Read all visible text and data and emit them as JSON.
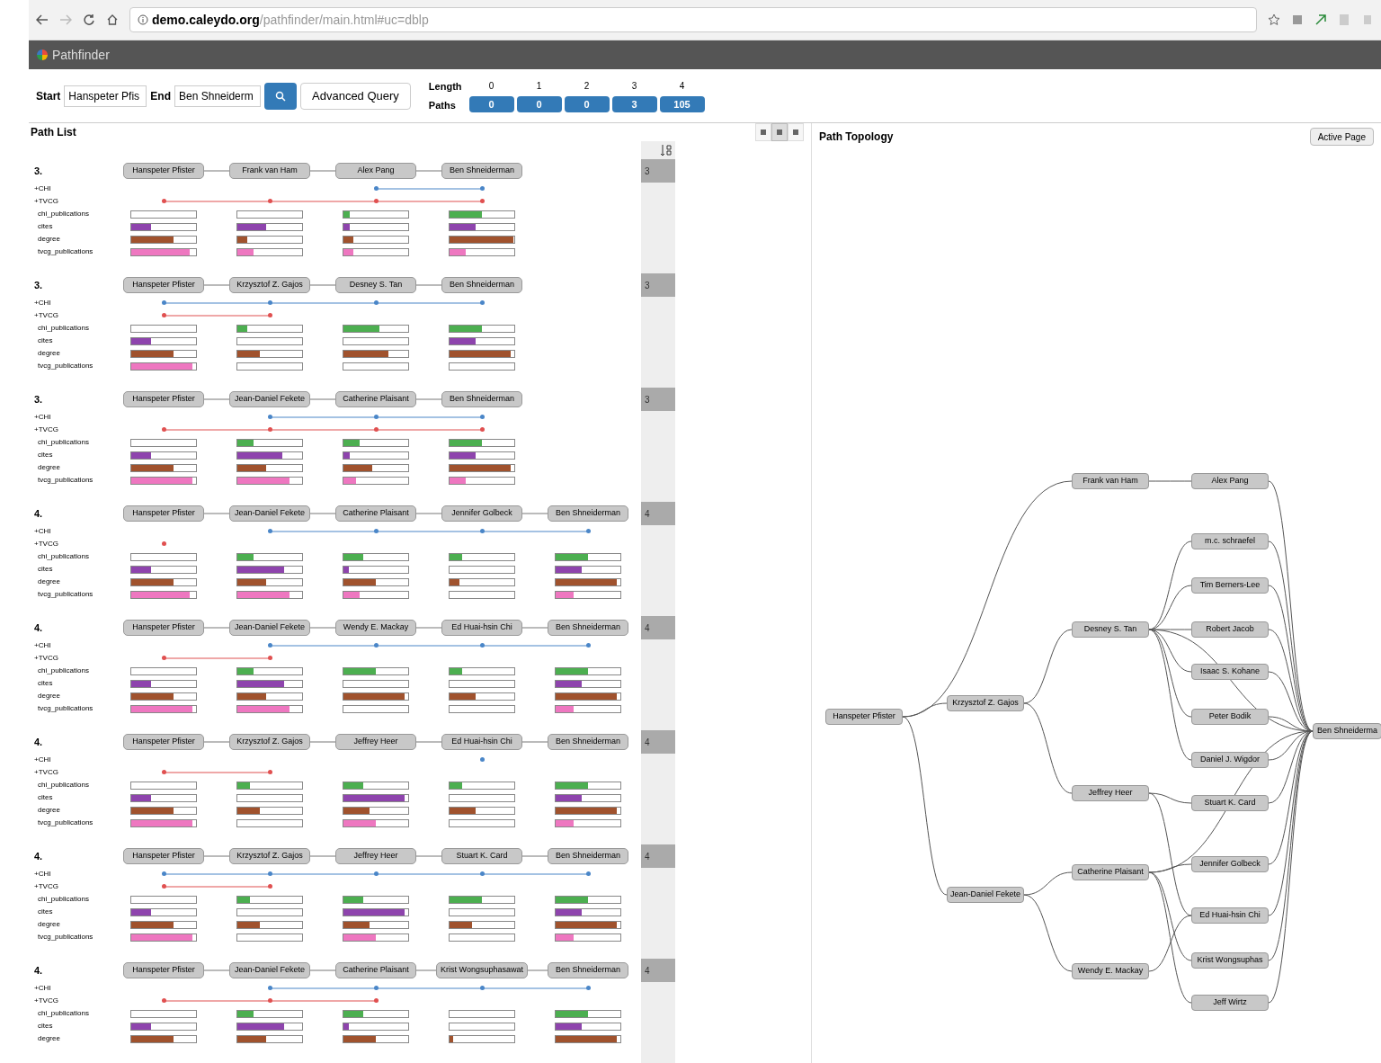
{
  "browser": {
    "url_host": "demo.caleydo.org",
    "url_path": "/pathfinder/main.html#uc=dblp"
  },
  "app": {
    "title": "Pathfinder"
  },
  "query": {
    "start_label": "Start",
    "start_value": "Hanspeter Pfis",
    "end_label": "End",
    "end_value": "Ben Shneiderm",
    "advanced_label": "Advanced Query",
    "length_label": "Length",
    "paths_label": "Paths",
    "length_columns": [
      {
        "length": "0",
        "paths": "0"
      },
      {
        "length": "1",
        "paths": "0"
      },
      {
        "length": "2",
        "paths": "0"
      },
      {
        "length": "3",
        "paths": "3"
      },
      {
        "length": "4",
        "paths": "105"
      }
    ]
  },
  "path_list": {
    "title": "Path List",
    "view_modes": [
      {
        "selected": false
      },
      {
        "selected": true
      },
      {
        "selected": false
      }
    ],
    "paths": [
      {
        "rank": "3.",
        "length": "3",
        "nodes": [
          "Hanspeter Pfister",
          "Frank van Ham",
          "Alex Pang",
          "Ben Shneiderman"
        ],
        "sets": [
          {
            "label": "+CHI",
            "color": "#4a86c8",
            "members": [
              false,
              false,
              true,
              true
            ]
          },
          {
            "label": "+TVCG",
            "color": "#e05050",
            "members": [
              true,
              true,
              true,
              true
            ]
          }
        ],
        "attributes": [
          {
            "label": "chi_publications",
            "color": "#4caf50",
            "values": [
              {
                "level": 0
              },
              {
                "level": 0
              },
              {
                "level": 0.1
              },
              {
                "level": 0.5
              }
            ]
          },
          {
            "label": "cites",
            "color": "#8e44ad",
            "values": [
              {
                "level": 0.3
              },
              {
                "level": 0.45
              },
              {
                "level": 0.1
              },
              {
                "level": 0.4
              }
            ]
          },
          {
            "label": "degree",
            "color": "#a0522d",
            "values": [
              {
                "level": 0.65
              },
              {
                "level": 0.15
              },
              {
                "level": 0.15
              },
              {
                "level": 0.98
              }
            ]
          },
          {
            "label": "tvcg_publications",
            "color": "#ee77c0",
            "values": [
              {
                "level": 0.9
              },
              {
                "level": 0.25
              },
              {
                "level": 0.15
              },
              {
                "level": 0.25
              }
            ]
          }
        ]
      },
      {
        "rank": "3.",
        "length": "3",
        "nodes": [
          "Hanspeter Pfister",
          "Krzysztof Z. Gajos",
          "Desney S. Tan",
          "Ben Shneiderman"
        ],
        "sets": [
          {
            "label": "+CHI",
            "color": "#4a86c8",
            "members": [
              true,
              true,
              true,
              true
            ]
          },
          {
            "label": "+TVCG",
            "color": "#e05050",
            "members": [
              true,
              true,
              false,
              false
            ]
          }
        ],
        "attributes": [
          {
            "label": "chi_publications",
            "color": "#4caf50",
            "values": [
              {
                "level": 0
              },
              {
                "level": 0.15
              },
              {
                "level": 0.55
              },
              {
                "level": 0.5
              }
            ]
          },
          {
            "label": "cites",
            "color": "#8e44ad",
            "values": [
              {
                "level": 0.3
              },
              {
                "level": 0
              },
              {
                "level": 0
              },
              {
                "level": 0.4
              }
            ]
          },
          {
            "label": "degree",
            "color": "#a0522d",
            "values": [
              {
                "level": 0.65
              },
              {
                "level": 0.35
              },
              {
                "level": 0.7
              },
              {
                "level": 0.95
              }
            ]
          },
          {
            "label": "tvcg_publications",
            "color": "#ee77c0",
            "values": [
              {
                "level": 0.95
              },
              {
                "level": 0
              },
              {
                "level": 0
              },
              {
                "level": 0
              }
            ]
          }
        ]
      },
      {
        "rank": "3.",
        "length": "3",
        "nodes": [
          "Hanspeter Pfister",
          "Jean-Daniel Fekete",
          "Catherine Plaisant",
          "Ben Shneiderman"
        ],
        "sets": [
          {
            "label": "+CHI",
            "color": "#4a86c8",
            "members": [
              false,
              true,
              true,
              true
            ]
          },
          {
            "label": "+TVCG",
            "color": "#e05050",
            "members": [
              true,
              true,
              true,
              true
            ]
          }
        ],
        "attributes": [
          {
            "label": "chi_publications",
            "color": "#4caf50",
            "values": [
              {
                "level": 0
              },
              {
                "level": 0.25
              },
              {
                "level": 0.25
              },
              {
                "level": 0.5
              }
            ]
          },
          {
            "label": "cites",
            "color": "#8e44ad",
            "values": [
              {
                "level": 0.3
              },
              {
                "level": 0.7
              },
              {
                "level": 0.1
              },
              {
                "level": 0.4
              }
            ]
          },
          {
            "label": "degree",
            "color": "#a0522d",
            "values": [
              {
                "level": 0.65
              },
              {
                "level": 0.45
              },
              {
                "level": 0.45
              },
              {
                "level": 0.95
              }
            ]
          },
          {
            "label": "tvcg_publications",
            "color": "#ee77c0",
            "values": [
              {
                "level": 0.95
              },
              {
                "level": 0.8
              },
              {
                "level": 0.2
              },
              {
                "level": 0.25
              }
            ]
          }
        ]
      },
      {
        "rank": "4.",
        "length": "4",
        "nodes": [
          "Hanspeter Pfister",
          "Jean-Daniel Fekete",
          "Catherine Plaisant",
          "Jennifer Golbeck",
          "Ben Shneiderman"
        ],
        "sets": [
          {
            "label": "+CHI",
            "color": "#4a86c8",
            "members": [
              false,
              true,
              true,
              true,
              true
            ]
          },
          {
            "label": "+TVCG",
            "color": "#e05050",
            "members": [
              true,
              false,
              false,
              false,
              false
            ]
          }
        ],
        "attributes": [
          {
            "label": "chi_publications",
            "color": "#4caf50",
            "values": [
              {
                "level": 0
              },
              {
                "level": 0.25
              },
              {
                "level": 0.3
              },
              {
                "level": 0.2
              },
              {
                "level": 0.5
              }
            ]
          },
          {
            "label": "cites",
            "color": "#8e44ad",
            "values": [
              {
                "level": 0.3
              },
              {
                "level": 0.72
              },
              {
                "level": 0.08
              },
              {
                "level": 0
              },
              {
                "level": 0.4
              }
            ]
          },
          {
            "label": "degree",
            "color": "#a0522d",
            "values": [
              {
                "level": 0.65
              },
              {
                "level": 0.45
              },
              {
                "level": 0.5
              },
              {
                "level": 0.15
              },
              {
                "level": 0.95
              }
            ]
          },
          {
            "label": "tvcg_publications",
            "color": "#ee77c0",
            "values": [
              {
                "level": 0.9
              },
              {
                "level": 0.8
              },
              {
                "level": 0.25
              },
              {
                "level": 0
              },
              {
                "level": 0.28
              }
            ]
          }
        ]
      },
      {
        "rank": "4.",
        "length": "4",
        "nodes": [
          "Hanspeter Pfister",
          "Jean-Daniel Fekete",
          "Wendy E. Mackay",
          "Ed Huai-hsin Chi",
          "Ben Shneiderman"
        ],
        "sets": [
          {
            "label": "+CHI",
            "color": "#4a86c8",
            "members": [
              false,
              true,
              true,
              true,
              true
            ]
          },
          {
            "label": "+TVCG",
            "color": "#e05050",
            "members": [
              true,
              true,
              false,
              false,
              false
            ]
          }
        ],
        "attributes": [
          {
            "label": "chi_publications",
            "color": "#4caf50",
            "values": [
              {
                "level": 0
              },
              {
                "level": 0.25
              },
              {
                "level": 0.5
              },
              {
                "level": 0.2
              },
              {
                "level": 0.5
              }
            ]
          },
          {
            "label": "cites",
            "color": "#8e44ad",
            "values": [
              {
                "level": 0.3
              },
              {
                "level": 0.72
              },
              {
                "level": 0
              },
              {
                "level": 0
              },
              {
                "level": 0.4
              }
            ]
          },
          {
            "label": "degree",
            "color": "#a0522d",
            "values": [
              {
                "level": 0.65
              },
              {
                "level": 0.45
              },
              {
                "level": 0.95
              },
              {
                "level": 0.4
              },
              {
                "level": 0.95
              }
            ]
          },
          {
            "label": "tvcg_publications",
            "color": "#ee77c0",
            "values": [
              {
                "level": 0.95
              },
              {
                "level": 0.8
              },
              {
                "level": 0
              },
              {
                "level": 0
              },
              {
                "level": 0.28
              }
            ]
          }
        ]
      },
      {
        "rank": "4.",
        "length": "4",
        "nodes": [
          "Hanspeter Pfister",
          "Krzysztof Z. Gajos",
          "Jeffrey Heer",
          "Ed Huai-hsin Chi",
          "Ben Shneiderman"
        ],
        "sets": [
          {
            "label": "+CHI",
            "color": "#4a86c8",
            "members": [
              false,
              false,
              false,
              true,
              false
            ]
          },
          {
            "label": "+TVCG",
            "color": "#e05050",
            "members": [
              true,
              true,
              false,
              false,
              false
            ]
          }
        ],
        "attributes": [
          {
            "label": "chi_publications",
            "color": "#4caf50",
            "values": [
              {
                "level": 0
              },
              {
                "level": 0.2
              },
              {
                "level": 0.3
              },
              {
                "level": 0.2
              },
              {
                "level": 0.5
              }
            ]
          },
          {
            "label": "cites",
            "color": "#8e44ad",
            "values": [
              {
                "level": 0.3
              },
              {
                "level": 0
              },
              {
                "level": 0.95
              },
              {
                "level": 0
              },
              {
                "level": 0.4
              }
            ]
          },
          {
            "label": "degree",
            "color": "#a0522d",
            "values": [
              {
                "level": 0.65
              },
              {
                "level": 0.35
              },
              {
                "level": 0.4
              },
              {
                "level": 0.4
              },
              {
                "level": 0.95
              }
            ]
          },
          {
            "label": "tvcg_publications",
            "color": "#ee77c0",
            "values": [
              {
                "level": 0.95
              },
              {
                "level": 0
              },
              {
                "level": 0.5
              },
              {
                "level": 0
              },
              {
                "level": 0.28
              }
            ]
          }
        ]
      },
      {
        "rank": "4.",
        "length": "4",
        "nodes": [
          "Hanspeter Pfister",
          "Krzysztof Z. Gajos",
          "Jeffrey Heer",
          "Stuart K. Card",
          "Ben Shneiderman"
        ],
        "sets": [
          {
            "label": "+CHI",
            "color": "#4a86c8",
            "members": [
              true,
              true,
              true,
              true,
              true
            ]
          },
          {
            "label": "+TVCG",
            "color": "#e05050",
            "members": [
              true,
              true,
              false,
              false,
              false
            ]
          }
        ],
        "attributes": [
          {
            "label": "chi_publications",
            "color": "#4caf50",
            "values": [
              {
                "level": 0
              },
              {
                "level": 0.2
              },
              {
                "level": 0.3
              },
              {
                "level": 0.5
              },
              {
                "level": 0.5
              }
            ]
          },
          {
            "label": "cites",
            "color": "#8e44ad",
            "values": [
              {
                "level": 0.3
              },
              {
                "level": 0
              },
              {
                "level": 0.95
              },
              {
                "level": 0
              },
              {
                "level": 0.4
              }
            ]
          },
          {
            "label": "degree",
            "color": "#a0522d",
            "values": [
              {
                "level": 0.65
              },
              {
                "level": 0.35
              },
              {
                "level": 0.4
              },
              {
                "level": 0.35
              },
              {
                "level": 0.95
              }
            ]
          },
          {
            "label": "tvcg_publications",
            "color": "#ee77c0",
            "values": [
              {
                "level": 0.95
              },
              {
                "level": 0
              },
              {
                "level": 0.5
              },
              {
                "level": 0
              },
              {
                "level": 0.28
              }
            ]
          }
        ]
      },
      {
        "rank": "4.",
        "length": "4",
        "nodes": [
          "Hanspeter Pfister",
          "Jean-Daniel Fekete",
          "Catherine Plaisant",
          "Krist Wongsuphasawat",
          "Ben Shneiderman"
        ],
        "sets": [
          {
            "label": "+CHI",
            "color": "#4a86c8",
            "members": [
              false,
              true,
              true,
              true,
              true
            ]
          },
          {
            "label": "+TVCG",
            "color": "#e05050",
            "members": [
              true,
              true,
              true,
              false,
              false
            ]
          }
        ],
        "attributes": [
          {
            "label": "chi_publications",
            "color": "#4caf50",
            "values": [
              {
                "level": 0
              },
              {
                "level": 0.25
              },
              {
                "level": 0.3
              },
              {
                "level": 0
              },
              {
                "level": 0.5
              }
            ]
          },
          {
            "label": "cites",
            "color": "#8e44ad",
            "values": [
              {
                "level": 0.3
              },
              {
                "level": 0.72
              },
              {
                "level": 0.08
              },
              {
                "level": 0
              },
              {
                "level": 0.4
              }
            ]
          },
          {
            "label": "degree",
            "color": "#a0522d",
            "values": [
              {
                "level": 0.65
              },
              {
                "level": 0.45
              },
              {
                "level": 0.5
              },
              {
                "level": 0.05
              },
              {
                "level": 0.95
              }
            ]
          }
        ]
      }
    ]
  },
  "topology": {
    "title": "Path Topology",
    "button": "Active Page",
    "nodes": [
      "Hanspeter Pfister",
      "Krzysztof Z. Gajos",
      "Jean-Daniel Fekete",
      "Frank van Ham",
      "Desney S. Tan",
      "Jeffrey Heer",
      "Catherine Plaisant",
      "Wendy E. Mackay",
      "Alex Pang",
      "m.c. schraefel",
      "Tim Berners-Lee",
      "Robert Jacob",
      "Isaac S. Kohane",
      "Peter Bodik",
      "Daniel J. Wigdor",
      "Stuart K. Card",
      "Jennifer Golbeck",
      "Ed Huai-hsin Chi",
      "Krist Wongsuphas",
      "Jeff Wirtz",
      "Ben Shneiderma"
    ]
  }
}
